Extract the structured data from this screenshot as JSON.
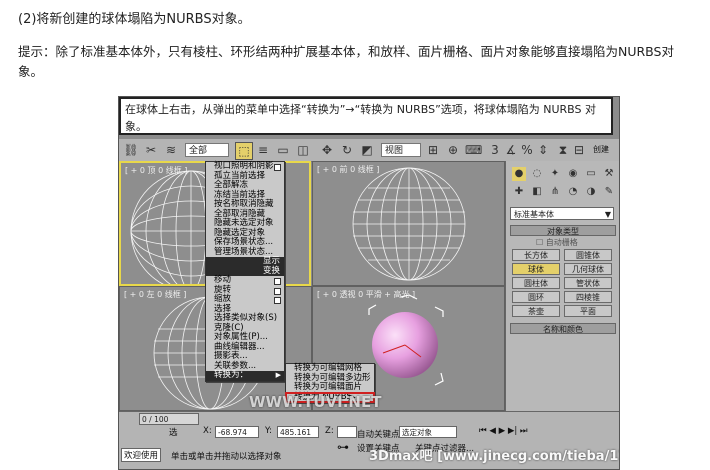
{
  "article": {
    "heading": "(2)将新创建的球体塌陷为NURBS对象。",
    "tip": "提示：除了标准基本体外，只有棱柱、环形结两种扩展基本体，和放样、面片栅格、面片对象能够直接塌陷为NURBS对象。"
  },
  "caption": "在球体上右击，从弹出的菜单中选择“转换为”→“转换为 NURBS”选项，将球体塌陷为 NURBS 对象。",
  "toolbar": {
    "selection_filter": "全部",
    "reference_coord": "视图",
    "right_label": "创建"
  },
  "viewports": [
    {
      "label": "[ + 0 顶 0 线框 ]"
    },
    {
      "label": "[ + 0 前 0 线框 ]"
    },
    {
      "label": "[ + 0 左 0 线框 ]"
    },
    {
      "label": "[ + 0 透视 0 平滑 + 高光 ]"
    }
  ],
  "context_menu": {
    "items_top": [
      "视口照明和阴影",
      "孤立当前选择",
      "全部解冻",
      "冻结当前选择",
      "按名称取消隐藏",
      "全部取消隐藏",
      "隐藏未选定对象",
      "隐藏选定对象",
      "保存场景状态...",
      "管理场景状态..."
    ],
    "header1": "显示",
    "header2": "变换",
    "items_bottom": [
      "移动",
      "旋转",
      "缩放",
      "选择",
      "选择类似对象(S)",
      "克隆(C)",
      "对象属性(P)...",
      "曲线编辑器...",
      "摄影表...",
      "关联参数..."
    ],
    "convert_to": "转换为：",
    "submenu": [
      "转换为可编辑网格",
      "转换为可编辑多边形",
      "转换为可编辑面片",
      "转换为 NURBS"
    ]
  },
  "command_panel": {
    "category": "标准基本体",
    "object_type_title": "对象类型",
    "autogrid": "自动栅格",
    "buttons": [
      "长方体",
      "圆锥体",
      "球体",
      "几何球体",
      "圆柱体",
      "管状体",
      "圆环",
      "四棱锥",
      "茶壶",
      "平面"
    ],
    "name_color": "名称和颜色"
  },
  "status": {
    "frame": "0 / 100",
    "x_label": "X:",
    "x_value": "-68.974",
    "y_label": "Y:",
    "y_value": "485.161",
    "z_label": "Z:",
    "autokey": "自动关键点",
    "setkey": "设置关键点",
    "selected_object": "选定对象",
    "keyfilter": "关键点过滤器...",
    "select_label": "选",
    "welcome": "欢迎使用",
    "prompt": "单击或单击并拖动以选择对象"
  },
  "watermarks": {
    "center": "WWW.TUVI.NET",
    "bottom": "3Dmax吧 [www.jinecg.com/tieba/1771]"
  },
  "colors": {
    "viewport_bg": "#8e8e8e",
    "active_border": "#e8d84a",
    "sphere_pink": "#e7a0e0",
    "highlight_red": "#d02020"
  }
}
